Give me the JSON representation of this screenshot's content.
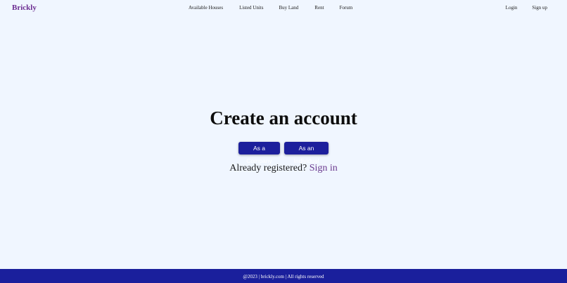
{
  "header": {
    "brand": "Brickly",
    "nav": [
      {
        "label": "Available Houses"
      },
      {
        "label": "Listed Units"
      },
      {
        "label": "Buy Land"
      },
      {
        "label": "Rent"
      },
      {
        "label": "Forum"
      }
    ],
    "auth": {
      "login": "Login",
      "signup": "Sign up"
    }
  },
  "main": {
    "title": "Create an account",
    "buttons": {
      "company": "As a Company",
      "individual": "As an Individual"
    },
    "signin_prompt": "Already registered? ",
    "signin_link": "Sign in"
  },
  "footer": {
    "text": "@2023 | brickly.com | All rights reserved"
  },
  "colors": {
    "background": "#f0f6ff",
    "brand": "#6b2c91",
    "primary": "#1c1f9c",
    "link": "#6b3a8f"
  }
}
